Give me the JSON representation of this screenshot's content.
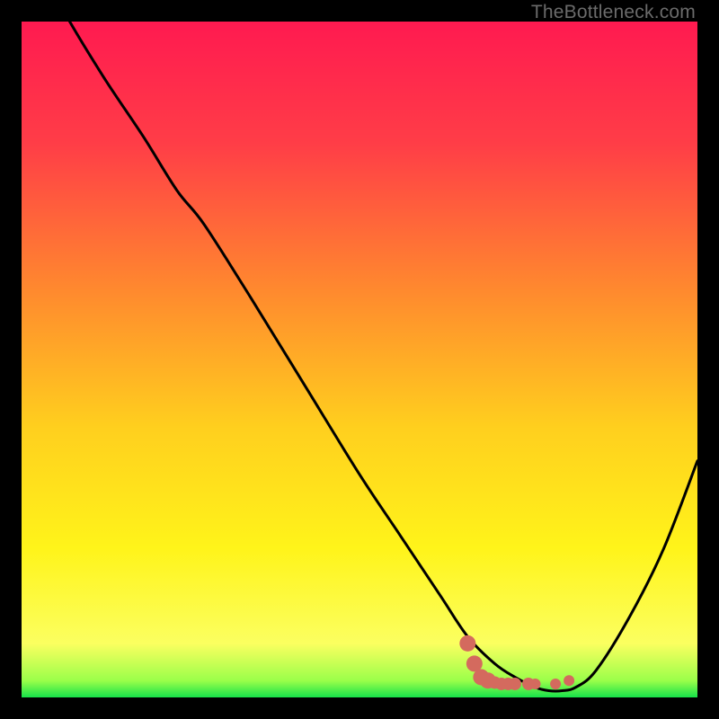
{
  "watermark": "TheBottleneck.com",
  "chart_data": {
    "type": "line",
    "title": "",
    "xlabel": "",
    "ylabel": "",
    "xlim": [
      0,
      100
    ],
    "ylim": [
      0,
      100
    ],
    "grid": false,
    "gradient_stops": [
      {
        "offset": 0.0,
        "color": "#ff1a50"
      },
      {
        "offset": 0.18,
        "color": "#ff3d47"
      },
      {
        "offset": 0.4,
        "color": "#ff8a2e"
      },
      {
        "offset": 0.6,
        "color": "#ffcf1e"
      },
      {
        "offset": 0.78,
        "color": "#fff41a"
      },
      {
        "offset": 0.92,
        "color": "#fbff60"
      },
      {
        "offset": 0.975,
        "color": "#9bff4a"
      },
      {
        "offset": 1.0,
        "color": "#16e24a"
      }
    ],
    "series": [
      {
        "name": "bottleneck-curve",
        "x": [
          0,
          6,
          12,
          18,
          23,
          27,
          34,
          42,
          50,
          56,
          62,
          66,
          70,
          73,
          76,
          78,
          80,
          82,
          85,
          90,
          95,
          100
        ],
        "y": [
          114,
          102,
          92,
          83,
          75,
          70,
          59,
          46,
          33,
          24,
          15,
          9,
          5,
          3,
          1.5,
          1,
          1,
          1.5,
          4,
          12,
          22,
          35
        ]
      }
    ],
    "markers": {
      "name": "highlight-markers",
      "color": "#d46a5e",
      "points": [
        {
          "x": 66,
          "y": 8
        },
        {
          "x": 67,
          "y": 5
        },
        {
          "x": 68,
          "y": 3
        },
        {
          "x": 69,
          "y": 2.5
        },
        {
          "x": 70,
          "y": 2.2
        },
        {
          "x": 71,
          "y": 2
        },
        {
          "x": 72,
          "y": 2
        },
        {
          "x": 73,
          "y": 2
        },
        {
          "x": 75,
          "y": 2
        },
        {
          "x": 76,
          "y": 2
        },
        {
          "x": 79,
          "y": 2
        },
        {
          "x": 81,
          "y": 2.5
        }
      ]
    }
  }
}
